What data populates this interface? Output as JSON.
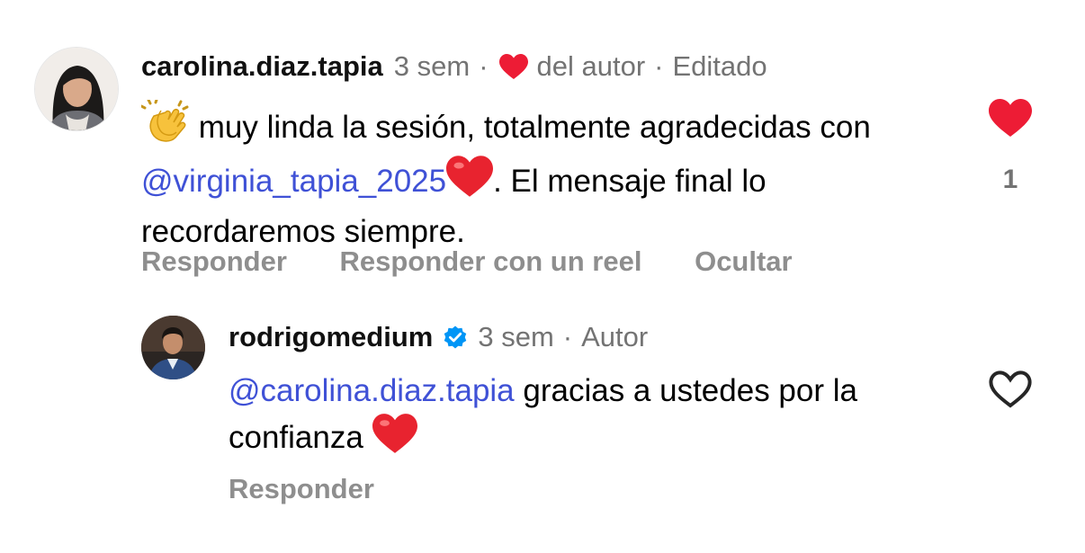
{
  "comments": [
    {
      "username": "carolina.diaz.tapia",
      "time": "3 sem",
      "separator1": "·",
      "liked_by_author": "del autor",
      "separator2": "·",
      "edited": "Editado",
      "text_1": " muy linda la sesión, totalmente agradecidas con ",
      "mention": "@virginia_tapia_2025",
      "text_2": ". El mensaje final lo recordaremos siempre.",
      "like_count": "1",
      "liked": true,
      "actions": {
        "reply": "Responder",
        "reply_reel": "Responder con un reel",
        "hide": "Ocultar"
      }
    },
    {
      "username": "rodrigomedium",
      "verified": true,
      "time": "3 sem",
      "separator1": "·",
      "author_label": "Autor",
      "mention": "@carolina.diaz.tapia",
      "text_1": " gracias a ustedes por la confianza ",
      "liked": false,
      "actions": {
        "reply": "Responder"
      }
    }
  ],
  "colors": {
    "heart": "#ed1c35",
    "mention": "#3f51d6",
    "muted": "#737373",
    "action": "#8e8e8e",
    "verified": "#0095f6"
  },
  "icons": [
    "clapping-hands-emoji",
    "heart-emoji",
    "heart-icon",
    "heart-outline-icon",
    "verified-badge-icon"
  ]
}
